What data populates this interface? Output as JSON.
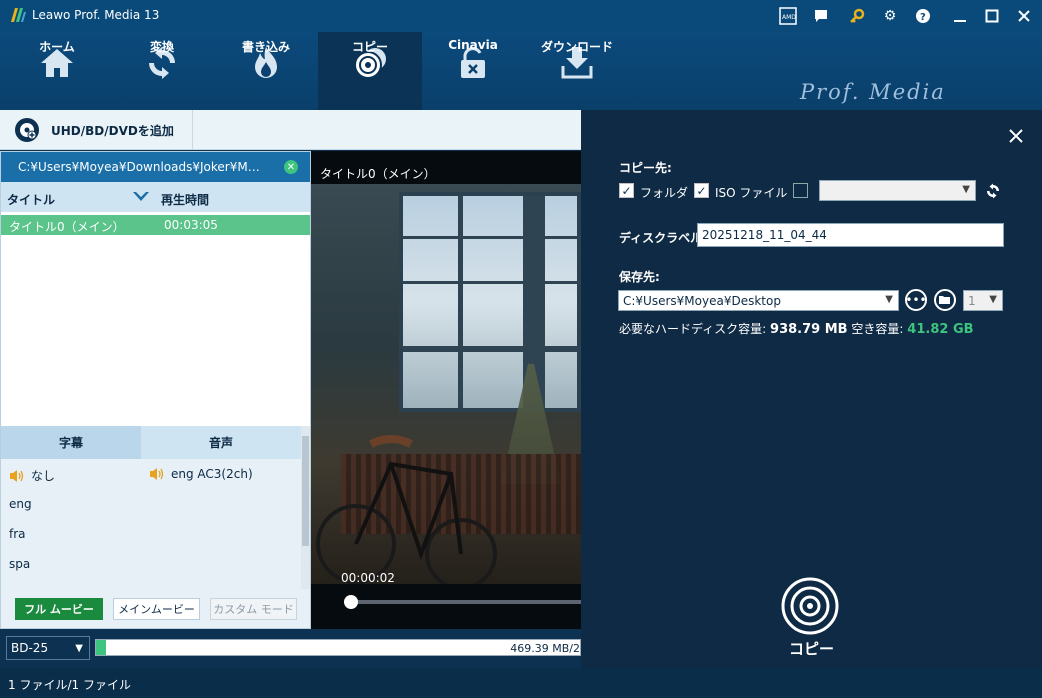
{
  "app": {
    "title": "Leawo Prof. Media 13"
  },
  "titlebar_icons": [
    "amd-icon",
    "feedback-icon",
    "key-icon",
    "gear-icon",
    "help-icon",
    "minimize-icon",
    "maximize-icon",
    "close-icon"
  ],
  "toolbar": {
    "items": [
      {
        "label": "ホーム",
        "icon": "home-icon"
      },
      {
        "label": "変換",
        "icon": "convert-icon"
      },
      {
        "label": "書き込み",
        "icon": "burn-icon"
      },
      {
        "label": "コピー",
        "icon": "copy-disc-icon",
        "active": true
      },
      {
        "label": "Cinavia",
        "icon": "cinavia-icon"
      },
      {
        "label": "ダウンロード",
        "icon": "download-icon"
      }
    ],
    "brand": "Prof. Media"
  },
  "subbar": {
    "add_label": "UHD/BD/DVDを追加"
  },
  "source": {
    "path": "C:¥Users¥Moyea¥Downloads¥Joker¥M…",
    "col_title": "タイトル",
    "col_duration": "再生時間",
    "titles": [
      {
        "name": "タイトル0（メイン）",
        "duration": "00:03:05"
      }
    ]
  },
  "tracks": {
    "subtitle_tab": "字幕",
    "audio_tab": "音声",
    "subtitles": [
      "なし",
      "eng",
      "fra",
      "spa"
    ],
    "audio": [
      "eng AC3(2ch)"
    ]
  },
  "modes": {
    "full": "フル ムービー",
    "main": "メインムービー",
    "custom": "カスタム モード"
  },
  "preview": {
    "title": "タイトル0（メイン）",
    "time": "00:00:02"
  },
  "bottom": {
    "disc_type": "BD-25",
    "capacity_text": "469.39 MB/2",
    "capacity_fraction": 0.02
  },
  "status": {
    "text": "1 ファイル/1 ファイル"
  },
  "copy_panel": {
    "copy_to_label": "コピー先:",
    "folder_label": "フォルダ",
    "folder_checked": true,
    "iso_label": "ISO ファイル",
    "iso_checked": true,
    "drive_checked": false,
    "drive_value": "",
    "disc_label_label": "ディスクラベル:",
    "disc_label_value": "20251218_11_04_44",
    "save_to_label": "保存先:",
    "save_path": "C:¥Users¥Moyea¥Desktop",
    "copies_value": "1",
    "required_label": "必要なハードディスク容量:",
    "required_value": "938.79 MB",
    "free_label": "空き容量:",
    "free_value": "41.82 GB",
    "copy_button": "コピー"
  },
  "colors": {
    "accent_green": "#3dc47e",
    "dark_panel": "#0e2a44",
    "header_blue": "#0a4a7a"
  }
}
